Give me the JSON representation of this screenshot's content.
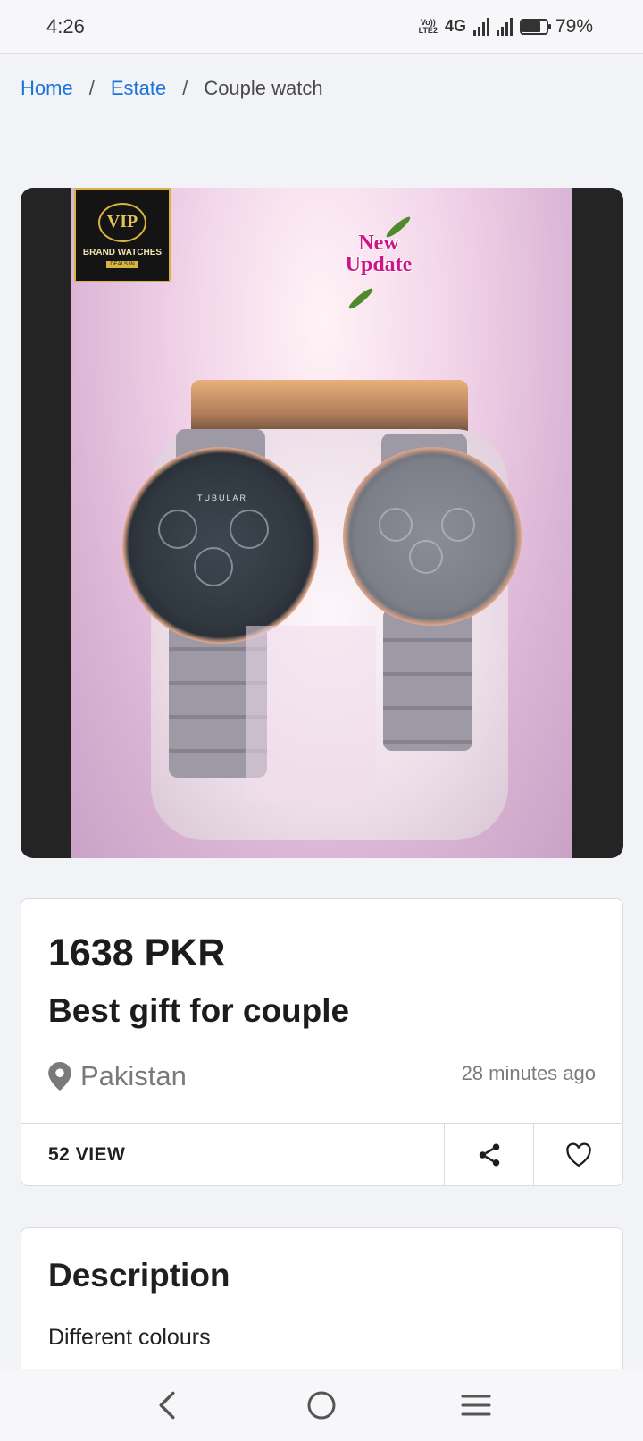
{
  "status_bar": {
    "time": "4:26",
    "volte_label": "Vo)) LTE2",
    "network": "4G",
    "battery_percent": "79%",
    "battery_level": 0.79
  },
  "breadcrumb": {
    "items": [
      "Home",
      "Estate",
      "Couple watch"
    ],
    "separator": "/"
  },
  "gallery": {
    "logo_text": "VIP",
    "logo_subtitle": "BRAND WATCHES",
    "logo_tag": "DEALS IN",
    "sticker_line1": "New",
    "sticker_line2": "Update",
    "watch_brand": "TUBULAR"
  },
  "listing": {
    "price": "1638 PKR",
    "title": "Best gift for couple",
    "location": "Pakistan",
    "posted": "28 minutes ago",
    "views": "52 VIEW",
    "icons": {
      "location": "map-pin-icon",
      "share": "share-icon",
      "favorite": "heart-icon"
    }
  },
  "description": {
    "heading": "Description",
    "text": "Different colours"
  },
  "nav": {
    "icons": [
      "back-icon",
      "home-icon",
      "menu-icon"
    ]
  },
  "colors": {
    "link": "#1a73d9",
    "background": "#f2f3f7",
    "gallery_bg": "#242424"
  }
}
